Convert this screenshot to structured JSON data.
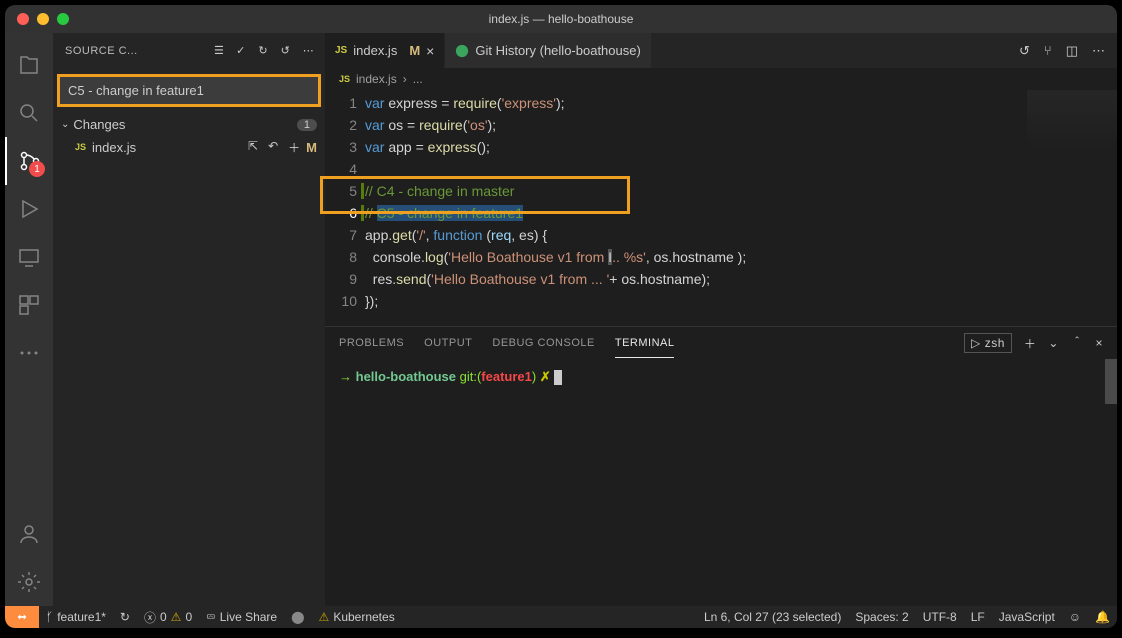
{
  "window": {
    "title": "index.js — hello-boathouse"
  },
  "sidebar": {
    "title": "SOURCE C...",
    "commit_msg": "C5 - change in feature1",
    "changes_label": "Changes",
    "changes_count": "1",
    "file": {
      "name": "index.js",
      "badge": "M"
    },
    "scm_badge": "1"
  },
  "tabs": {
    "t1": {
      "label": "index.js",
      "badge": "M",
      "lang": "JS"
    },
    "t2": {
      "label": "Git History (hello-boathouse)",
      "iconColor": "#3ba55d"
    }
  },
  "breadcrumb": {
    "file": "index.js",
    "sep": "›",
    "rest": "..."
  },
  "editor": {
    "lines": [
      "1",
      "2",
      "3",
      "4",
      "5",
      "6",
      "7",
      "8",
      "9",
      "10"
    ],
    "code": {
      "l1a": "var",
      "l1b": " express = ",
      "l1c": "require",
      "l1d": "(",
      "l1e": "'express'",
      "l1f": ");",
      "l2a": "var",
      "l2b": " os = ",
      "l2c": "require",
      "l2d": "(",
      "l2e": "'os'",
      "l2f": ");",
      "l3a": "var",
      "l3b": " app = ",
      "l3c": "express",
      "l3d": "();",
      "l5": "// C4 - change in master",
      "l6a": "// ",
      "l6b": "C5 - change in feature1",
      "l7a": "app.",
      "l7b": "get",
      "l7c": "(",
      "l7d": "'/'",
      "l7e": ", ",
      "l7f": "function",
      "l7g": " (",
      "l7h": "req",
      "l7i": ", ",
      "l7j": "",
      "l7k": "es) {",
      "l8a": "  console.",
      "l8b": "log",
      "l8c": "(",
      "l8d": "'Hello Boathouse v1 from ",
      "l8cur": "I",
      "l8e": ".. %s'",
      "l8f": ", os.hostname );",
      "l9a": "  res.",
      "l9b": "send",
      "l9c": "(",
      "l9d": "'Hello Boathouse v1 from ... '",
      "l9e": "+ os.hostname);",
      "l10": "});"
    }
  },
  "panel": {
    "tabs": {
      "problems": "PROBLEMS",
      "output": "OUTPUT",
      "debug": "DEBUG CONSOLE",
      "terminal": "TERMINAL"
    },
    "shell": "zsh",
    "term": {
      "arrow": "→ ",
      "folder": "hello-boathouse ",
      "git": "git:(",
      "branch": "feature1",
      "close": ") ",
      "star": "✗ "
    }
  },
  "status": {
    "branch": "feature1*",
    "sync": "↻",
    "errors": "0",
    "warnings": "0",
    "liveshare": "Live Share",
    "quokka": "⬤",
    "kubernetes": "Kubernetes",
    "selection": "Ln 6, Col 27 (23 selected)",
    "spaces": "Spaces: 2",
    "encoding": "UTF-8",
    "eol": "LF",
    "language": "JavaScript",
    "feedback": "☺"
  },
  "chart_data": null
}
